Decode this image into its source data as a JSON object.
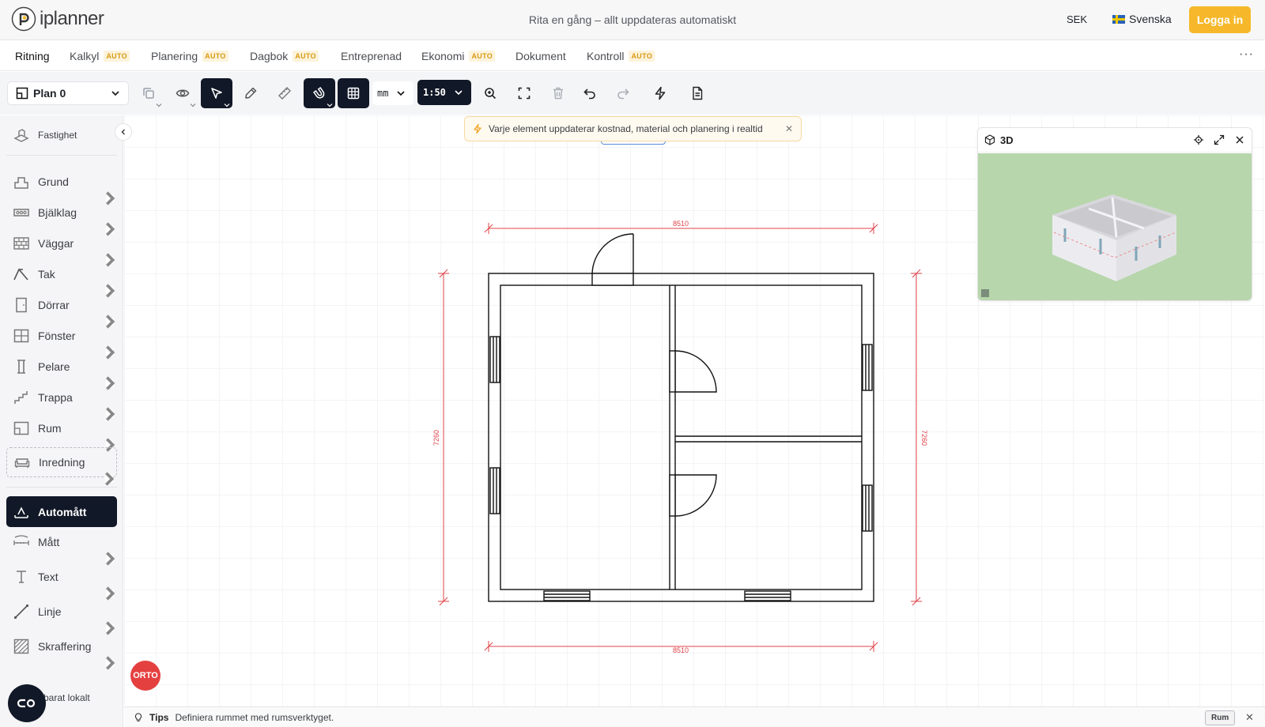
{
  "header": {
    "logo_text": "iplanner",
    "message": "Rita en gång – allt uppdateras automatiskt",
    "currency": "SEK",
    "language": "Svenska",
    "login_label": "Logga in"
  },
  "tabs": [
    {
      "label": "Ritning",
      "auto": "",
      "active": true
    },
    {
      "label": "Kalkyl",
      "auto": "AUTO"
    },
    {
      "label": "Planering",
      "auto": "AUTO"
    },
    {
      "label": "Dagbok",
      "auto": "AUTO"
    },
    {
      "label": "Entreprenad",
      "auto": ""
    },
    {
      "label": "Ekonomi",
      "auto": "AUTO"
    },
    {
      "label": "Dokument",
      "auto": ""
    },
    {
      "label": "Kontroll",
      "auto": "AUTO"
    }
  ],
  "toolbar": {
    "plan_label": "Plan 0",
    "unit": "mm",
    "scale": "1:50"
  },
  "sidebar": {
    "property_label": "Fastighet",
    "items": [
      {
        "label": "Grund",
        "icon": "foundation-icon"
      },
      {
        "label": "Bjälklag",
        "icon": "joist-icon"
      },
      {
        "label": "Väggar",
        "icon": "wall-icon"
      },
      {
        "label": "Tak",
        "icon": "roof-icon"
      },
      {
        "label": "Dörrar",
        "icon": "door-icon"
      },
      {
        "label": "Fönster",
        "icon": "window-icon"
      },
      {
        "label": "Pelare",
        "icon": "pillar-icon"
      },
      {
        "label": "Trappa",
        "icon": "stairs-icon"
      },
      {
        "label": "Rum",
        "icon": "room-icon"
      },
      {
        "label": "Inredning",
        "icon": "furniture-icon"
      }
    ],
    "tools": [
      {
        "label": "Automått",
        "icon": "auto-dimension-icon",
        "active": true
      },
      {
        "label": "Mått",
        "icon": "dimension-icon"
      },
      {
        "label": "Text",
        "icon": "text-icon"
      },
      {
        "label": "Linje",
        "icon": "line-icon"
      },
      {
        "label": "Skraffering",
        "icon": "hatching-icon"
      }
    ],
    "local_text": "barat lokalt"
  },
  "toast": {
    "message": "Varje element uppdaterar kostnad, material och planering i realtid"
  },
  "plan": {
    "dimension_top": "8510",
    "dimension_bottom": "8510",
    "dimension_left": "7260",
    "dimension_right": "7260"
  },
  "panel3d": {
    "title": "3D"
  },
  "orto_label": "ORTO",
  "tips": {
    "label": "Tips",
    "text": "Definiera rummet med rumsverktyget.",
    "button": "Rum"
  },
  "colors": {
    "accent": "#f6b82a",
    "dark": "#111827",
    "dimension": "#e0434a",
    "ground": "#b7d6ac",
    "orto": "#e54040"
  }
}
